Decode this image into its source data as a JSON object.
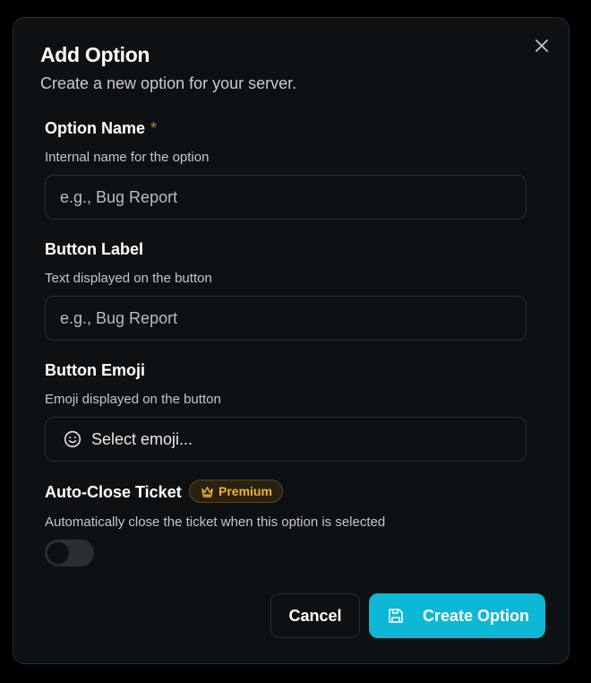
{
  "dialog": {
    "title": "Add Option",
    "subtitle": "Create a new option for your server."
  },
  "fields": {
    "option_name": {
      "label": "Option Name",
      "required_mark": "*",
      "help": "Internal name for the option",
      "placeholder": "e.g., Bug Report",
      "value": ""
    },
    "button_label": {
      "label": "Button Label",
      "help": "Text displayed on the button",
      "placeholder": "e.g., Bug Report",
      "value": ""
    },
    "button_emoji": {
      "label": "Button Emoji",
      "help": "Emoji displayed on the button",
      "placeholder": "Select emoji...",
      "icon": "smile-icon"
    },
    "auto_close": {
      "label": "Auto-Close Ticket",
      "badge": "Premium",
      "badge_icon": "crown-icon",
      "help": "Automatically close the ticket when this option is selected",
      "enabled": false
    }
  },
  "actions": {
    "cancel_label": "Cancel",
    "create_label": "Create Option",
    "create_icon": "save-icon"
  },
  "colors": {
    "background": "#0e1114",
    "border": "#2a2e33",
    "accent": "#0db7d6",
    "premium": "#f0b42a",
    "required": "#b08a2c"
  }
}
